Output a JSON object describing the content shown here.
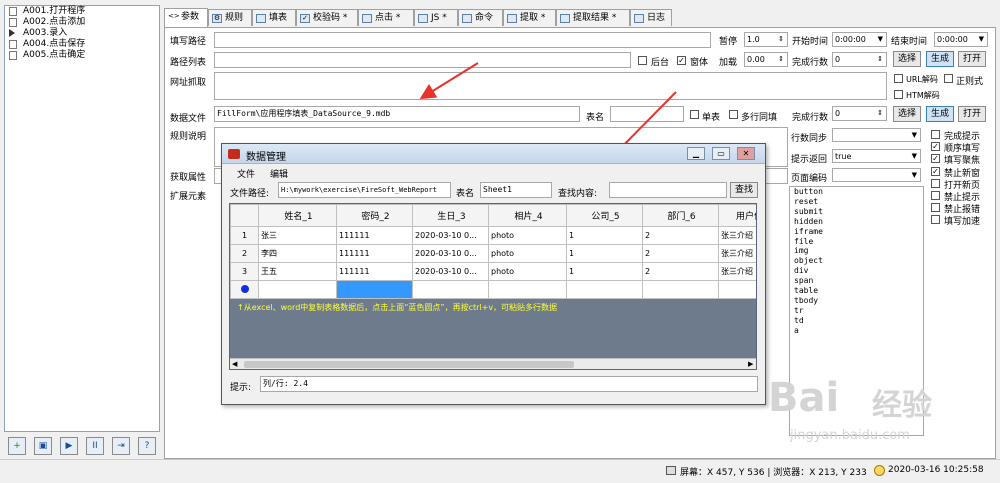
{
  "sidebar": {
    "items": [
      {
        "label": "A001.打开程序"
      },
      {
        "label": "A002.点击添加"
      },
      {
        "label": "A003.录入"
      },
      {
        "label": "A004.点击保存"
      },
      {
        "label": "A005.点击确定"
      }
    ],
    "toolbar": [
      "+",
      "▣",
      "▶",
      "II",
      "⇥",
      "?"
    ]
  },
  "tabs": [
    {
      "label": "参数"
    },
    {
      "label": "规则"
    },
    {
      "label": "填表"
    },
    {
      "label": "校验码 *"
    },
    {
      "label": "点击 *"
    },
    {
      "label": "JS *"
    },
    {
      "label": "命令"
    },
    {
      "label": "提取 *"
    },
    {
      "label": "提取结果 *"
    },
    {
      "label": "日志"
    }
  ],
  "form": {
    "fill_path_label": "填写路径",
    "path_list_label": "路径列表",
    "url_grab_label": "网址抓取",
    "data_file_label": "数据文件",
    "data_file_value": "FillForm\\应用程序填表_DataSource_9.mdb",
    "table_name_label": "表名",
    "single_table_label": "单表",
    "multi_row_label": "多行同填",
    "rule_desc_label": "规则说明",
    "get_attr_label": "获取属性",
    "ext_elem_label": "扩展元素",
    "pause_label": "暂停",
    "pause_value": "1.0",
    "start_time_label": "开始时间",
    "start_time_value": "0:00:00",
    "end_time_label": "结束时间",
    "end_time_value": "0:00:00",
    "backend_label": "后台",
    "window_label": "窗体",
    "load_label": "加载",
    "load_value": "0.00",
    "done_rows_label": "完成行数",
    "done_rows_value": "0",
    "done_rows2_label": "完成行数",
    "done_rows2_value": "0",
    "select_label": "选择",
    "generate_label": "生成",
    "open_label": "打开",
    "select2_label": "选择",
    "generate2_label": "生成",
    "open2_label": "打开",
    "url_decode_label": "URL解码",
    "regex_label": "正则式",
    "htm_decode_label": "HTM解码",
    "col_sync_label": "行数同步",
    "hint_return_label": "提示返回",
    "hint_return_value": "true",
    "page_encoding_label": "页面编码"
  },
  "options": [
    {
      "label": "完成提示",
      "checked": false
    },
    {
      "label": "顺序填写",
      "checked": true
    },
    {
      "label": "填写聚焦",
      "checked": true
    },
    {
      "label": "禁止新窗",
      "checked": true
    },
    {
      "label": "打开新页",
      "checked": false
    },
    {
      "label": "禁止提示",
      "checked": false
    },
    {
      "label": "禁止报错",
      "checked": false
    },
    {
      "label": "填写加速",
      "checked": false
    }
  ],
  "elements": [
    "button",
    "reset",
    "submit",
    "hidden",
    "iframe",
    "file",
    "img",
    "object",
    "div",
    "span",
    "table",
    "tbody",
    "tr",
    "td",
    "a"
  ],
  "dialog": {
    "title": "数据管理",
    "menu": [
      "文件",
      "编辑"
    ],
    "file_path_label": "文件路径:",
    "file_path_value": "H:\\mywork\\exercise\\FireSoft_WebReport",
    "table_label": "表名",
    "table_value": "Sheet1",
    "search_label": "查找内容:",
    "search_button": "查找",
    "columns": [
      "姓名_1",
      "密码_2",
      "生日_3",
      "相片_4",
      "公司_5",
      "部门_6",
      "用户信"
    ],
    "rows": [
      {
        "num": "1",
        "cells": [
          "张三",
          "111111",
          "2020-03-10 0...",
          "photo",
          "1",
          "2",
          "张三介绍"
        ]
      },
      {
        "num": "2",
        "cells": [
          "李四",
          "111111",
          "2020-03-10 0...",
          "photo",
          "1",
          "2",
          "张三介绍"
        ]
      },
      {
        "num": "3",
        "cells": [
          "王五",
          "111111",
          "2020-03-10 0...",
          "photo",
          "1",
          "2",
          "张三介绍"
        ]
      }
    ],
    "note": "↑从excel、word中复制表格数据后，点击上面“蓝色圆点”，再按ctrl+v，可粘贴多行数据",
    "hint_label": "提示:",
    "hint_value": "列/行: 2.4"
  },
  "status": {
    "screen": "屏幕：X 457, Y 536 | 浏览器：X 213, Y 233",
    "datetime": "2020-03-16 10:25:58"
  },
  "watermark": {
    "main": "Bai",
    "sub": "经验",
    "url": "jingyan.baidu.com"
  },
  "colors": {
    "arrow": "#e8322c",
    "accent": "#3c7fb1",
    "grid_bg": "#6d7b8d",
    "note_text": "#ffff33"
  }
}
